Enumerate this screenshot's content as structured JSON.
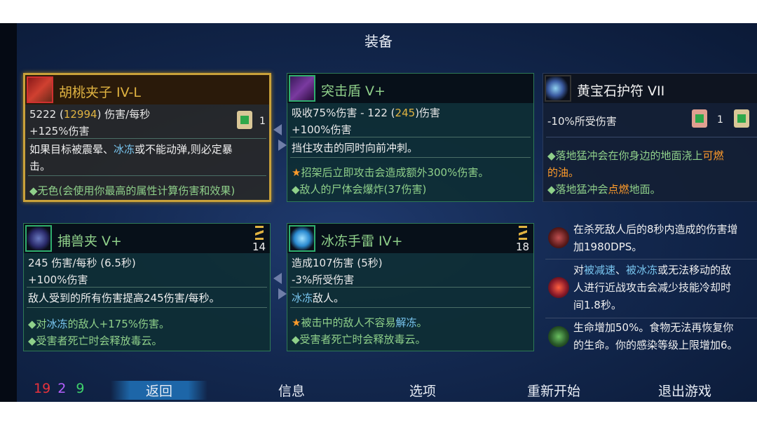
{
  "title": "装备",
  "cards": {
    "weapon1": {
      "name": "胡桃夹子 IV-L",
      "dps_base": "5222",
      "dps_crit": "12994",
      "dps_label": "伤害/每秒",
      "bonus": "+125%伤害",
      "scroll_count": "1",
      "desc_l1": "如果目标被震晕、",
      "desc_kw": "冰冻",
      "desc_l1b": "或不能动弹,则必定暴",
      "desc_l2": "击。",
      "affix": "◆无色(会使用你最高的属性计算伤害和效果)"
    },
    "weapon2": {
      "name": "突击盾 V+",
      "stat_a": "吸收75%伤害 - 122 (",
      "stat_b": "245",
      "stat_c": ")伤害",
      "bonus": "+100%伤害",
      "desc": "挡住攻击的同时向前冲刺。",
      "affix1": "招架后立即攻击会造成额外300%伤害。",
      "affix2": "◆敌人的尸体会爆炸(37伤害)"
    },
    "amulet": {
      "name": "黄宝石护符 VII",
      "stat": "-10%所受伤害",
      "scroll_count": "1",
      "affix1a": "◆落地猛冲会在你身边的地面浇上",
      "affix1b": "可燃",
      "affix1c": "的油。",
      "affix2a": "◆落地猛冲会",
      "affix2b": "点燃",
      "affix2c": "地面。"
    },
    "skill1": {
      "name": "捕兽夹 V+",
      "cooldown": "14",
      "stat": "245 伤害/每秒 (6.5秒)",
      "bonus": "+100%伤害",
      "desc": "敌人受到的所有伤害提高245伤害/每秒。",
      "affix1a": "◆对",
      "affix1b": "冰冻",
      "affix1c": "的敌人+175%伤害。",
      "affix2": "◆受害者死亡时会释放毒云。"
    },
    "skill2": {
      "name": "冰冻手雷 IV+",
      "cooldown": "18",
      "stat": "造成107伤害 (5秒)",
      "bonus": "-3%所受伤害",
      "desc_kw": "冰冻",
      "desc": "敌人。",
      "affix1a": "被击中的敌人不容易",
      "affix1b": "解冻",
      "affix1c": "。",
      "affix2": "◆受害者死亡时会释放毒云。"
    }
  },
  "mutations": [
    {
      "l1": "在杀死敌人后的8秒内造成的伤害增",
      "l2": "加1980DPS。"
    },
    {
      "l1a": "对",
      "kw1": "被减速",
      "l1b": "、",
      "kw2": "被冰冻",
      "l1c": "或无法移动的敌",
      "l2": "人进行近战攻击会减少技能冷却时",
      "l3": "间1.8秒。"
    },
    {
      "l1": "生命增加50%。食物无法再恢复你",
      "l2": "的生命。你的感染等级上限增加6。"
    }
  ],
  "scrolls": {
    "red": "19",
    "purple": "2",
    "green": "9"
  },
  "menu": {
    "back": "返回",
    "info": "信息",
    "options": "选项",
    "restart": "重新开始",
    "quit": "退出游戏"
  },
  "colors": {
    "red": "#e8323c",
    "purple": "#b560ff",
    "green": "#3fd36c",
    "gold": "#e0b341"
  }
}
